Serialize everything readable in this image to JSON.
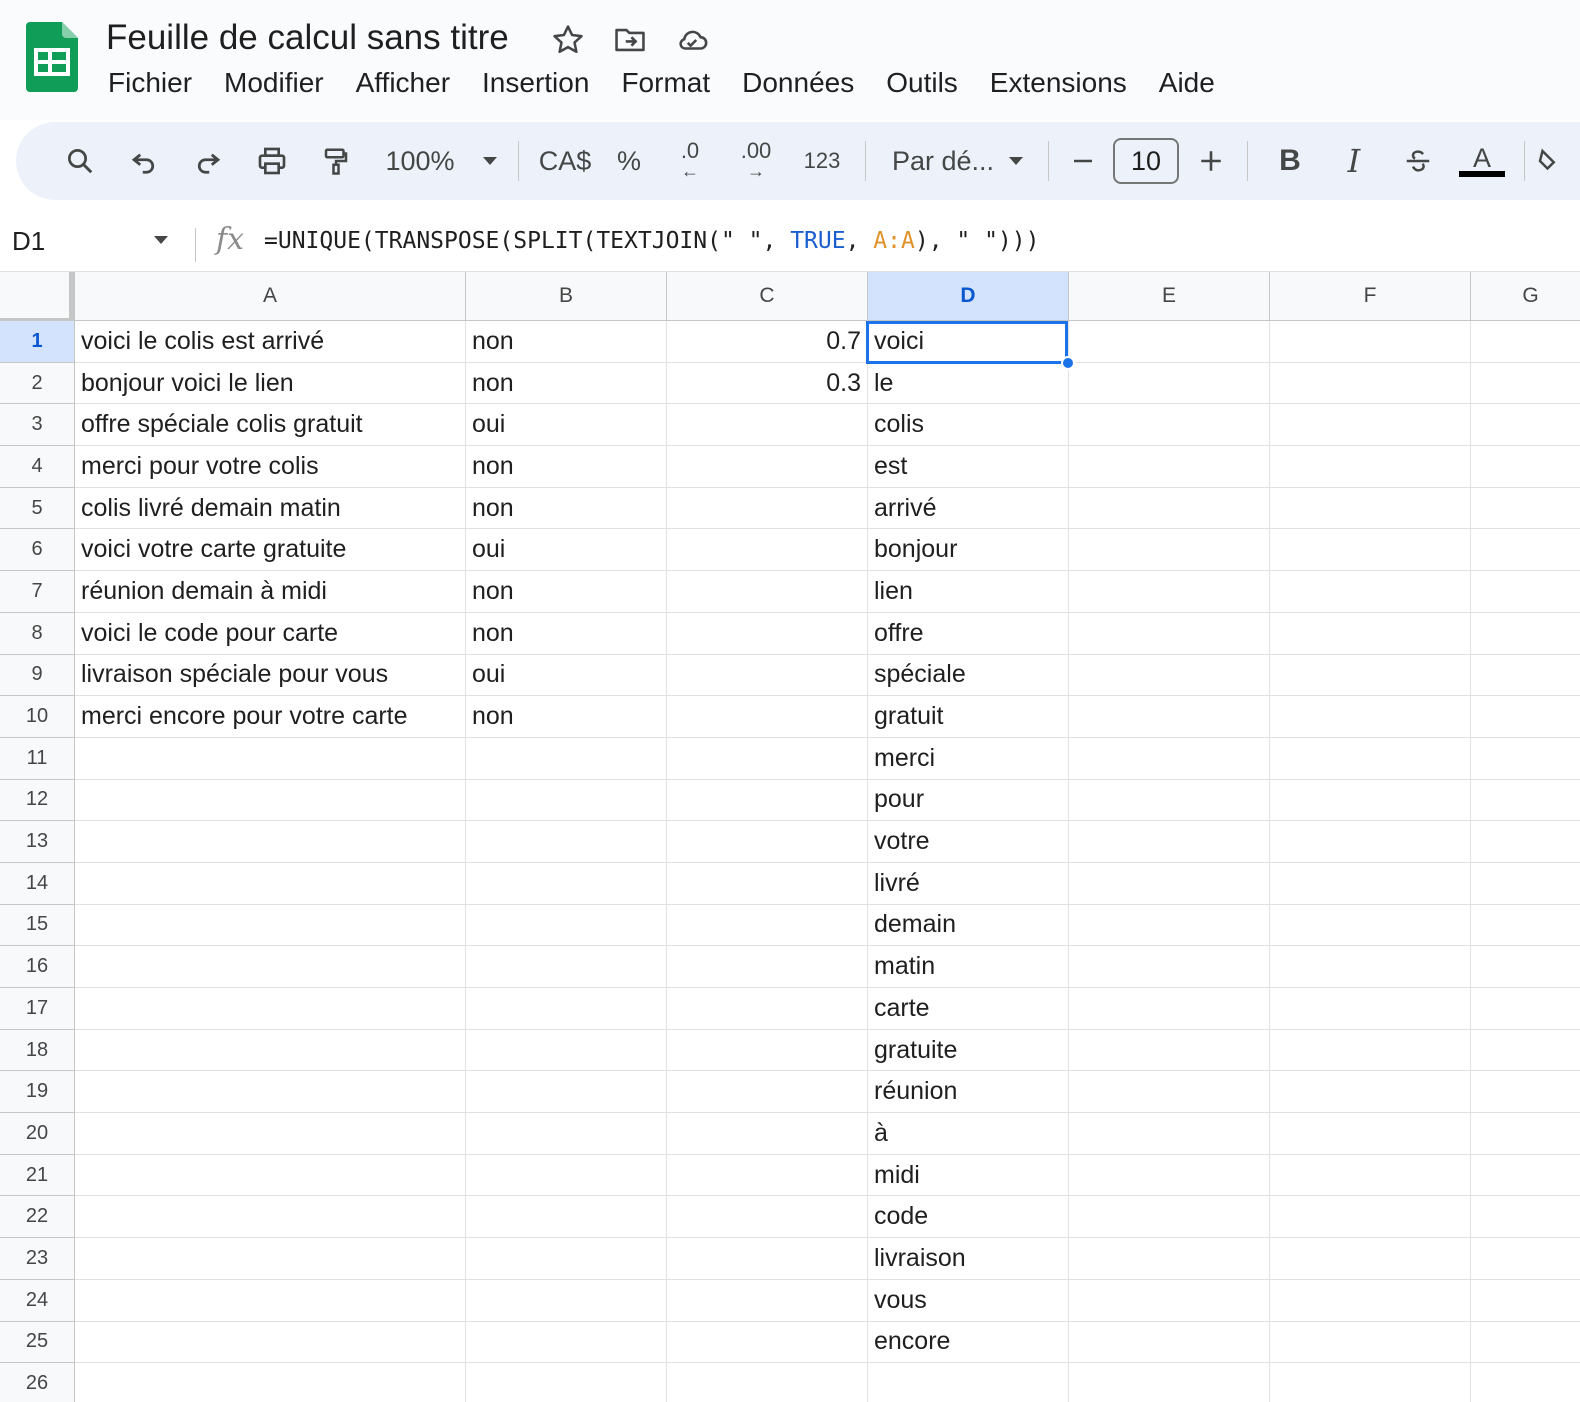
{
  "app": {
    "doc_title": "Feuille de calcul sans titre",
    "colors": {
      "logo_green": "#0f9d58",
      "selection_blue": "#1a73e8",
      "toolbar_bg": "#edf2fa"
    }
  },
  "menu": [
    "Fichier",
    "Modifier",
    "Afficher",
    "Insertion",
    "Format",
    "Données",
    "Outils",
    "Extensions",
    "Aide"
  ],
  "toolbar": {
    "zoom": "100%",
    "currency": "CA$",
    "percent": "%",
    "decrease_decimals": ".0",
    "increase_decimals": ".00",
    "number_format": "123",
    "font": "Par dé...",
    "font_size": "10",
    "bold": "B",
    "italic": "I",
    "text_color": "A",
    "icons": [
      "search-icon",
      "undo-icon",
      "redo-icon",
      "print-icon",
      "paint-format-icon",
      "strikethrough-icon",
      "fill-color-icon"
    ]
  },
  "formula_bar": {
    "name_box": "D1",
    "fx": "fx",
    "formula_parts": [
      "=UNIQUE(TRANSPOSE(SPLIT(TEXTJOIN(\" \", ",
      "TRUE",
      ", ",
      "A:A",
      "), \" \")))"
    ]
  },
  "grid": {
    "columns": [
      "A",
      "B",
      "C",
      "D",
      "E",
      "F",
      "G"
    ],
    "selected_column": "D",
    "selected_row": 1,
    "rows": [
      {
        "n": "1",
        "A": "voici le colis est arrivé",
        "B": "non",
        "C": "0.7",
        "D": "voici"
      },
      {
        "n": "2",
        "A": "bonjour voici le lien",
        "B": "non",
        "C": "0.3",
        "D": "le"
      },
      {
        "n": "3",
        "A": "offre spéciale colis gratuit",
        "B": "oui",
        "C": "",
        "D": "colis"
      },
      {
        "n": "4",
        "A": "merci pour votre colis",
        "B": "non",
        "C": "",
        "D": "est"
      },
      {
        "n": "5",
        "A": "colis livré demain matin",
        "B": "non",
        "C": "",
        "D": "arrivé"
      },
      {
        "n": "6",
        "A": "voici votre carte gratuite",
        "B": "oui",
        "C": "",
        "D": "bonjour"
      },
      {
        "n": "7",
        "A": "réunion demain à midi",
        "B": "non",
        "C": "",
        "D": "lien"
      },
      {
        "n": "8",
        "A": "voici le code pour carte",
        "B": "non",
        "C": "",
        "D": "offre"
      },
      {
        "n": "9",
        "A": "livraison spéciale pour vous",
        "B": "oui",
        "C": "",
        "D": "spéciale"
      },
      {
        "n": "10",
        "A": "merci encore pour votre carte",
        "B": "non",
        "C": "",
        "D": "gratuit"
      },
      {
        "n": "11",
        "A": "",
        "B": "",
        "C": "",
        "D": "merci"
      },
      {
        "n": "12",
        "A": "",
        "B": "",
        "C": "",
        "D": "pour"
      },
      {
        "n": "13",
        "A": "",
        "B": "",
        "C": "",
        "D": "votre"
      },
      {
        "n": "14",
        "A": "",
        "B": "",
        "C": "",
        "D": "livré"
      },
      {
        "n": "15",
        "A": "",
        "B": "",
        "C": "",
        "D": "demain"
      },
      {
        "n": "16",
        "A": "",
        "B": "",
        "C": "",
        "D": "matin"
      },
      {
        "n": "17",
        "A": "",
        "B": "",
        "C": "",
        "D": "carte"
      },
      {
        "n": "18",
        "A": "",
        "B": "",
        "C": "",
        "D": "gratuite"
      },
      {
        "n": "19",
        "A": "",
        "B": "",
        "C": "",
        "D": "réunion"
      },
      {
        "n": "20",
        "A": "",
        "B": "",
        "C": "",
        "D": "à"
      },
      {
        "n": "21",
        "A": "",
        "B": "",
        "C": "",
        "D": "midi"
      },
      {
        "n": "22",
        "A": "",
        "B": "",
        "C": "",
        "D": "code"
      },
      {
        "n": "23",
        "A": "",
        "B": "",
        "C": "",
        "D": "livraison"
      },
      {
        "n": "24",
        "A": "",
        "B": "",
        "C": "",
        "D": "vous"
      },
      {
        "n": "25",
        "A": "",
        "B": "",
        "C": "",
        "D": "encore"
      },
      {
        "n": "26",
        "A": "",
        "B": "",
        "C": "",
        "D": ""
      }
    ]
  }
}
